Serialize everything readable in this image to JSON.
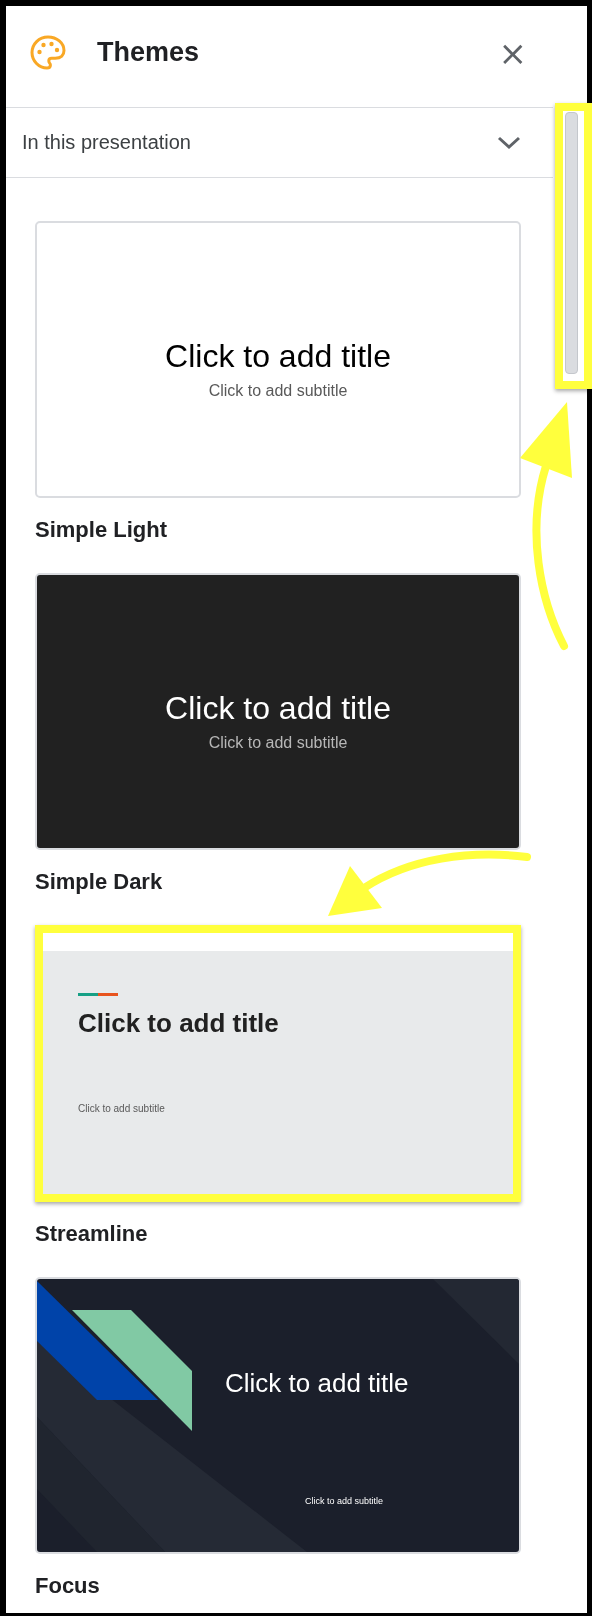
{
  "panel": {
    "title": "Themes",
    "close": "×"
  },
  "filter": {
    "label": "In this presentation",
    "expanded": false
  },
  "scrollbar": {
    "highlighted": true
  },
  "themes": [
    {
      "kind": "simple-light",
      "name": "Simple Light",
      "title": "Click to add title",
      "subtitle": "Click to add subtitle",
      "highlighted": false
    },
    {
      "kind": "simple-dark",
      "name": "Simple Dark",
      "title": "Click to add title",
      "subtitle": "Click to add subtitle",
      "highlighted": false
    },
    {
      "kind": "streamline",
      "name": "Streamline",
      "title": "Click to add title",
      "subtitle": "Click to add subtitle",
      "highlighted": true
    },
    {
      "kind": "focus",
      "name": "Focus",
      "title": "Click to add title",
      "subtitle": "Click to add subtitle",
      "highlighted": false
    }
  ],
  "annotation_arrows": [
    {
      "kind": "arrow"
    },
    {
      "kind": "arrow"
    }
  ]
}
